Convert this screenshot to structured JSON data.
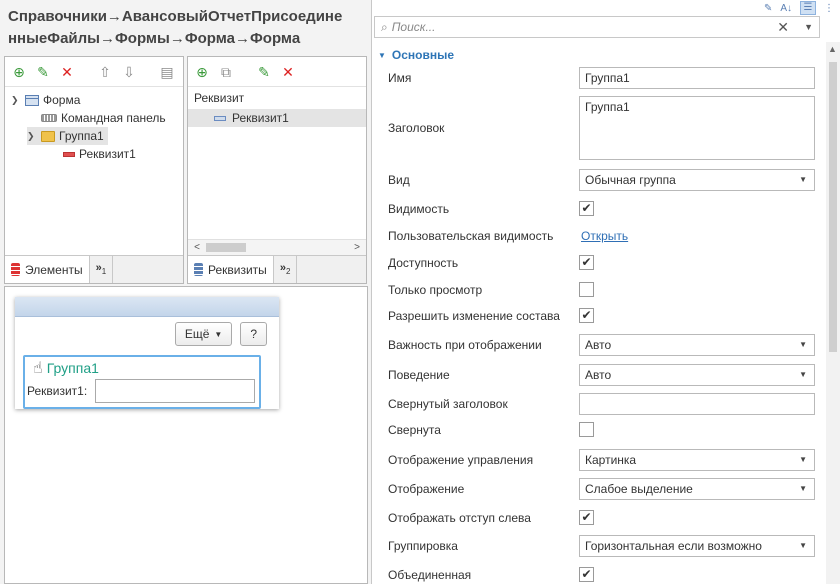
{
  "header": {
    "title_line1": "Справочники→АвансовыйОтчетПрисоедине",
    "title_line2": "нныеФайлы→Формы→Форма→Форма"
  },
  "elements_panel": {
    "toolbar_icons": [
      "add-icon",
      "edit-icon",
      "delete-icon",
      "move-up-icon",
      "move-down-icon",
      "panel-icon"
    ],
    "tree": [
      {
        "label": "Форма",
        "icon": "form-icon",
        "expanded": true
      },
      {
        "label": "Командная панель",
        "icon": "command-panel-icon"
      },
      {
        "label": "Группа1",
        "icon": "folder-icon",
        "expanded": true,
        "selected": true
      },
      {
        "label": "Реквизит1",
        "icon": "field-icon"
      }
    ],
    "tab_label": "Элементы",
    "tab_more": "»",
    "tab_more_sub": "1"
  },
  "requisites_panel": {
    "toolbar_icons": [
      "add-requisite-icon",
      "copy-icon",
      "edit-icon",
      "delete-icon"
    ],
    "header": "Реквизит",
    "rows": [
      {
        "label": "Реквизит1"
      }
    ],
    "tab_label": "Реквизиты",
    "tab_more": "»",
    "tab_more_sub": "2"
  },
  "preview": {
    "more_button": "Ещё",
    "help_button": "?",
    "group_title": "Группа1",
    "field_label": "Реквизит1:"
  },
  "properties": {
    "search_placeholder": "Поиск...",
    "section": "Основные",
    "items": [
      {
        "label": "Имя",
        "type": "text",
        "value": "Группа1"
      },
      {
        "label": "Заголовок",
        "type": "multiline",
        "value": "Группа1"
      },
      {
        "label": "Вид",
        "type": "select",
        "value": "Обычная группа"
      },
      {
        "label": "Видимость",
        "type": "checkbox",
        "checked": true,
        "mark": "✔"
      },
      {
        "label": "Пользовательская видимость",
        "type": "link",
        "value": "Открыть"
      },
      {
        "label": "Доступность",
        "type": "checkbox",
        "checked": true,
        "mark": "✔"
      },
      {
        "label": "Только просмотр",
        "type": "checkbox",
        "checked": false,
        "mark": ""
      },
      {
        "label": "Разрешить изменение состава",
        "type": "checkbox",
        "checked": true,
        "mark": "✔"
      },
      {
        "label": "Важность при отображении",
        "type": "select",
        "value": "Авто"
      },
      {
        "label": "Поведение",
        "type": "select",
        "value": "Авто"
      },
      {
        "label": "Свернутый заголовок",
        "type": "text",
        "value": ""
      },
      {
        "label": "Свернута",
        "type": "checkbox",
        "checked": false,
        "mark": ""
      },
      {
        "label": "Отображение управления",
        "type": "select",
        "value": "Картинка"
      },
      {
        "label": "Отображение",
        "type": "select",
        "value": "Слабое выделение"
      },
      {
        "label": "Отображать отступ слева",
        "type": "checkbox",
        "checked": true,
        "mark": "✔"
      },
      {
        "label": "Группировка",
        "type": "select",
        "value": "Горизонтальная если возможно"
      },
      {
        "label": "Объединенная",
        "type": "checkbox",
        "checked": true,
        "mark": "✔"
      }
    ]
  }
}
